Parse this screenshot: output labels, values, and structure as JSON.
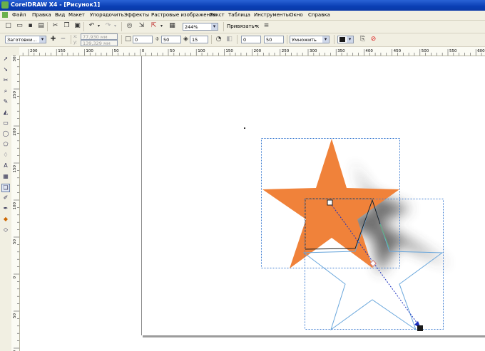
{
  "window": {
    "title": "CorelDRAW X4 - [Рисунок1]"
  },
  "menu": {
    "items": [
      "Файл",
      "Правка",
      "Вид",
      "Макет",
      "Упорядочить",
      "Эффекты",
      "Растровые изображения",
      "Текст",
      "Таблица",
      "Инструменты",
      "Окно",
      "Справка"
    ]
  },
  "standard_toolbar": {
    "zoom_value": "244%",
    "snap_label": "Привязать к"
  },
  "property_bar": {
    "preset_value": "Заготовки...",
    "x_value": "77,930 мм",
    "y_value": "139,329 мм",
    "opacity_value": "0",
    "feather_value": "50",
    "direction_value": "15",
    "fade_value": "0",
    "stretch_value": "50",
    "transparency_mode": "Умножить",
    "shadow_color": "#1a1a1a"
  },
  "ruler_h": {
    "labels": [
      "200",
      "150",
      "100",
      "50",
      "0",
      "50",
      "100",
      "150",
      "200",
      "250",
      "300",
      "350",
      "400",
      "450",
      "500",
      "550",
      "600"
    ]
  },
  "ruler_v": {
    "labels": [
      "300",
      "250",
      "200",
      "150",
      "100",
      "50",
      "0",
      "50",
      "100"
    ]
  },
  "colors": {
    "star_fill": "#f0823a",
    "star_outline": "#6aa7dc",
    "selection_box": "#3b7bd1",
    "shadow_dark": "#3c3c3c"
  },
  "icons": [
    "new-icon",
    "open-icon",
    "save-icon",
    "print-icon",
    "cut-icon",
    "copy-icon",
    "paste-icon",
    "undo-icon",
    "redo-icon",
    "import-icon",
    "export-icon",
    "launcher-icon",
    "zoom-icon"
  ]
}
